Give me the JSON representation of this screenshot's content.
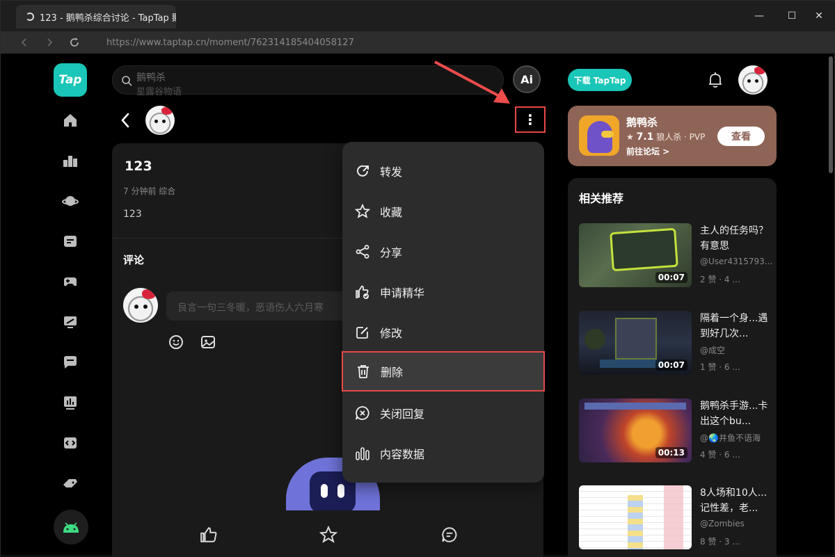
{
  "window": {
    "tab_title": "123 - 鹅鸭杀综合讨论 - TapTap 鹅",
    "url": "https://www.taptap.cn/moment/762314185404058127",
    "controls": {
      "minimize": "—",
      "maximize": "☐",
      "close": "✕"
    }
  },
  "nav": {
    "logo": "Tap",
    "icons": [
      "home-icon",
      "ranking-icon",
      "planet-icon",
      "ticket-icon",
      "gamepad-icon",
      "monitor-icon",
      "chat-icon",
      "chart-icon",
      "code-box-icon",
      "controller-icon"
    ],
    "android": "android-icon"
  },
  "search": {
    "placeholder": "鹅鸭杀",
    "suggestion": "星露谷物语"
  },
  "ai_button": "Ai",
  "post": {
    "title": "123",
    "meta": "7 分钟前  综合",
    "body": "123",
    "comments_heading": "评论",
    "comment_placeholder": "良言一句三冬暖，恶语伤人六月寒"
  },
  "menu": {
    "items": [
      {
        "label": "转发",
        "icon": "repost-icon"
      },
      {
        "label": "收藏",
        "icon": "star-icon"
      },
      {
        "label": "分享",
        "icon": "share-icon"
      },
      {
        "label": "申请精华",
        "icon": "thumb-badge-icon"
      },
      {
        "label": "修改",
        "icon": "edit-icon"
      },
      {
        "label": "删除",
        "icon": "trash-icon",
        "highlighted": true
      },
      {
        "label": "关闭回复",
        "icon": "close-reply-icon"
      },
      {
        "label": "内容数据",
        "icon": "bar-chart-icon"
      }
    ]
  },
  "header_right": {
    "download_label": "下载 TapTap"
  },
  "game": {
    "name": "鹅鸭杀",
    "rating": "7.1",
    "tags": "狼人杀 · PVP",
    "forum_link": "前往论坛 >",
    "view_label": "查看"
  },
  "recommendations": {
    "title": "相关推荐",
    "items": [
      {
        "title": "主人的任务吗？有意思",
        "author": "@User4315793...",
        "stats": "2 赞 · 4 ...",
        "duration": "00:07"
      },
      {
        "title": "隔着一个身...遇到好几次...",
        "author": "@成空",
        "stats": "1 赞 · 6 ...",
        "duration": "00:07"
      },
      {
        "title": "鹅鸭杀手游...卡出这个bu...",
        "author": "@🌏井鱼不语海",
        "stats": "4 赞 · 6 ...",
        "duration": "00:13"
      },
      {
        "title": "8人场和10人...记性差，老...",
        "author": "@Zombies",
        "stats": "8 赞 · 3 ...",
        "duration": ""
      }
    ]
  },
  "colors": {
    "accent": "#19c6b7",
    "highlight": "#e84848",
    "game_card": "#8e6456"
  }
}
